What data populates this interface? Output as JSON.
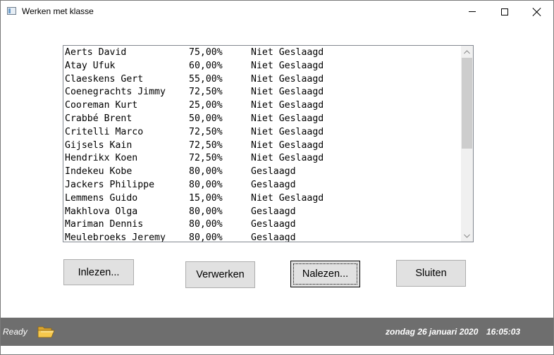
{
  "window": {
    "title": "Werken met klasse",
    "icon": "app-window-icon"
  },
  "controls": {
    "minimize": "minimize-icon",
    "maximize": "maximize-icon",
    "close": "close-icon"
  },
  "list": {
    "rows": [
      {
        "name": "Aerts David",
        "pct": "75,00%",
        "status": "Niet Geslaagd"
      },
      {
        "name": "Atay Ufuk",
        "pct": "60,00%",
        "status": "Niet Geslaagd"
      },
      {
        "name": "Claeskens Gert",
        "pct": "55,00%",
        "status": "Niet Geslaagd"
      },
      {
        "name": "Coenegrachts Jimmy",
        "pct": "72,50%",
        "status": "Niet Geslaagd"
      },
      {
        "name": "Cooreman Kurt",
        "pct": "25,00%",
        "status": "Niet Geslaagd"
      },
      {
        "name": "Crabbé Brent",
        "pct": "50,00%",
        "status": "Niet Geslaagd"
      },
      {
        "name": "Critelli Marco",
        "pct": "72,50%",
        "status": "Niet Geslaagd"
      },
      {
        "name": "Gijsels Kain",
        "pct": "72,50%",
        "status": "Niet Geslaagd"
      },
      {
        "name": "Hendrikx Koen",
        "pct": "72,50%",
        "status": "Niet Geslaagd"
      },
      {
        "name": "Indekeu Kobe",
        "pct": "80,00%",
        "status": "Geslaagd"
      },
      {
        "name": "Jackers Philippe",
        "pct": "80,00%",
        "status": "Geslaagd"
      },
      {
        "name": "Lemmens Guido",
        "pct": "15,00%",
        "status": "Niet Geslaagd"
      },
      {
        "name": "Makhlova Olga",
        "pct": "80,00%",
        "status": "Geslaagd"
      },
      {
        "name": "Mariman Dennis",
        "pct": "80,00%",
        "status": "Geslaagd"
      },
      {
        "name": "Meulebroeks Jeremy",
        "pct": "80,00%",
        "status": "Geslaagd"
      }
    ]
  },
  "buttons": {
    "inlezen": "Inlezen...",
    "verwerken": "Verwerken",
    "nalezen": "Nalezen...",
    "sluiten": "Sluiten"
  },
  "statusbar": {
    "ready": "Ready",
    "date": "zondag 26 januari 2020",
    "time": "16:05:03",
    "folder_icon": "open-folder-icon"
  },
  "colors": {
    "statusbar_bg": "#6e6e6e",
    "button_bg": "#e1e1e1",
    "scroll_thumb": "#cdcdcd"
  }
}
